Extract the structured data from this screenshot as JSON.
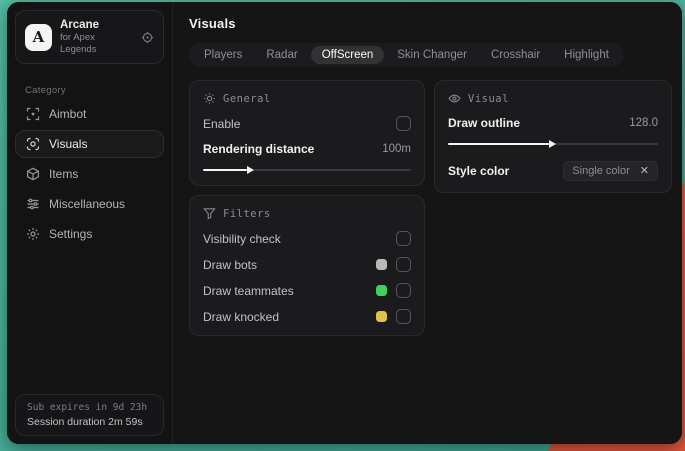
{
  "backdrop": {
    "teal": "#4BB39B",
    "orange": "#DD543E"
  },
  "window_bg": "#141415",
  "sidebar": {
    "logo_letter": "A",
    "app_name": "Arcane",
    "app_subtitle": "for Apex Legends",
    "header_icon": "target-icon",
    "category_label": "Category",
    "items": [
      {
        "label": "Aimbot",
        "icon": "crosshair-icon",
        "active": false
      },
      {
        "label": "Visuals",
        "icon": "eye-scan-icon",
        "active": true
      },
      {
        "label": "Items",
        "icon": "cube-icon",
        "active": false
      },
      {
        "label": "Miscellaneous",
        "icon": "sliders-icon",
        "active": false
      },
      {
        "label": "Settings",
        "icon": "gear-icon",
        "active": false
      }
    ],
    "footer": {
      "line1": "Sub expires in 9d 23h",
      "line2": "Session duration 2m 59s"
    }
  },
  "header": {
    "title": "Visuals"
  },
  "tabs": [
    {
      "label": "Players",
      "active": false
    },
    {
      "label": "Radar",
      "active": false
    },
    {
      "label": "OffScreen",
      "active": true
    },
    {
      "label": "Skin Changer",
      "active": false
    },
    {
      "label": "Crosshair",
      "active": false
    },
    {
      "label": "Highlight",
      "active": false
    }
  ],
  "panels": {
    "general": {
      "title": "General",
      "icon": "sun-icon",
      "enable_label": "Enable",
      "enable_checked": false,
      "rendering_distance_label": "Rendering distance",
      "rendering_distance_value": "100m",
      "rendering_distance_fill": "21%"
    },
    "visual": {
      "title": "Visual",
      "icon": "eye-icon",
      "draw_outline_label": "Draw outline",
      "draw_outline_value": "128.0",
      "draw_outline_fill": "48%",
      "style_color_label": "Style color",
      "style_color_value": "Single color",
      "style_color_clear_glyph": "✕"
    },
    "filters": {
      "title": "Filters",
      "icon": "funnel-icon",
      "rows": [
        {
          "label": "Visibility check",
          "swatch": null,
          "checked": false
        },
        {
          "label": "Draw bots",
          "swatch": "#b9b9b9",
          "checked": false
        },
        {
          "label": "Draw teammates",
          "swatch": "#41d05e",
          "checked": false
        },
        {
          "label": "Draw knocked",
          "swatch": "#dfc14c",
          "checked": false
        }
      ]
    }
  }
}
